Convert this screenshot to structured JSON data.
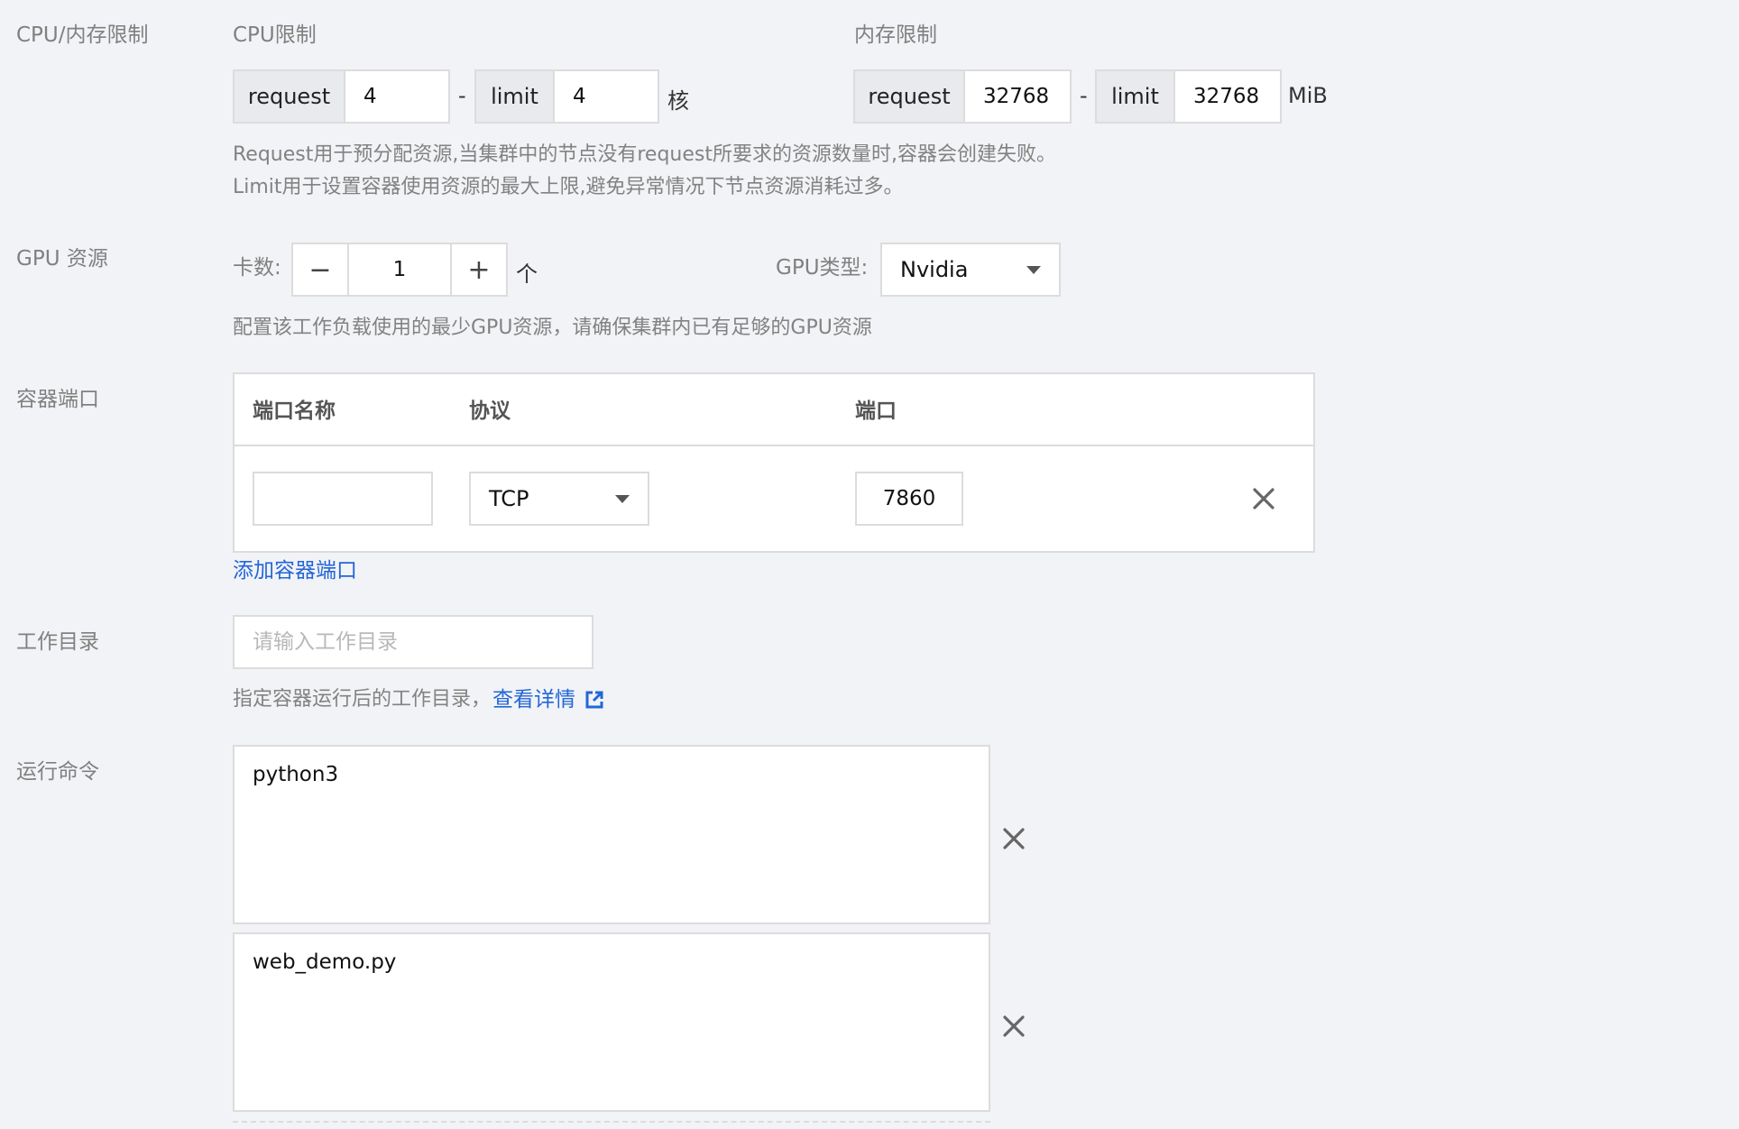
{
  "cpu_memory": {
    "label": "CPU/内存限制",
    "cpu": {
      "title": "CPU限制",
      "request_label": "request",
      "request_value": "4",
      "separator": "-",
      "limit_label": "limit",
      "limit_value": "4",
      "unit": "核"
    },
    "memory": {
      "title": "内存限制",
      "request_label": "request",
      "request_value": "32768",
      "separator": "-",
      "limit_label": "limit",
      "limit_value": "32768",
      "unit": "MiB"
    },
    "help_line1": "Request用于预分配资源,当集群中的节点没有request所要求的资源数量时,容器会创建失败。",
    "help_line2": "Limit用于设置容器使用资源的最大上限,避免异常情况下节点资源消耗过多。"
  },
  "gpu": {
    "label": "GPU 资源",
    "count_label": "卡数:",
    "minus_glyph": "−",
    "count_value": "1",
    "plus_glyph": "+",
    "count_unit": "个",
    "type_label": "GPU类型:",
    "type_value": "Nvidia",
    "help": "配置该工作负载使用的最少GPU资源，请确保集群内已有足够的GPU资源"
  },
  "ports": {
    "label": "容器端口",
    "headers": [
      "端口名称",
      "协议",
      "端口"
    ],
    "rows": [
      {
        "name": "",
        "protocol": "TCP",
        "port": "7860"
      }
    ],
    "add_link": "添加容器端口"
  },
  "workdir": {
    "label": "工作目录",
    "placeholder": "请输入工作目录",
    "help_text": "指定容器运行后的工作目录，",
    "help_link": "查看详情"
  },
  "command": {
    "label": "运行命令",
    "entries": [
      "python3",
      "web_demo.py"
    ]
  },
  "icons": {
    "delete": "close-icon",
    "external": "external-link-icon",
    "dropdown": "chevron-down-icon"
  },
  "colors": {
    "background": "#f2f3f6",
    "link": "#2266d8",
    "border": "#dcdcdc",
    "addon": "#e8eaee"
  }
}
